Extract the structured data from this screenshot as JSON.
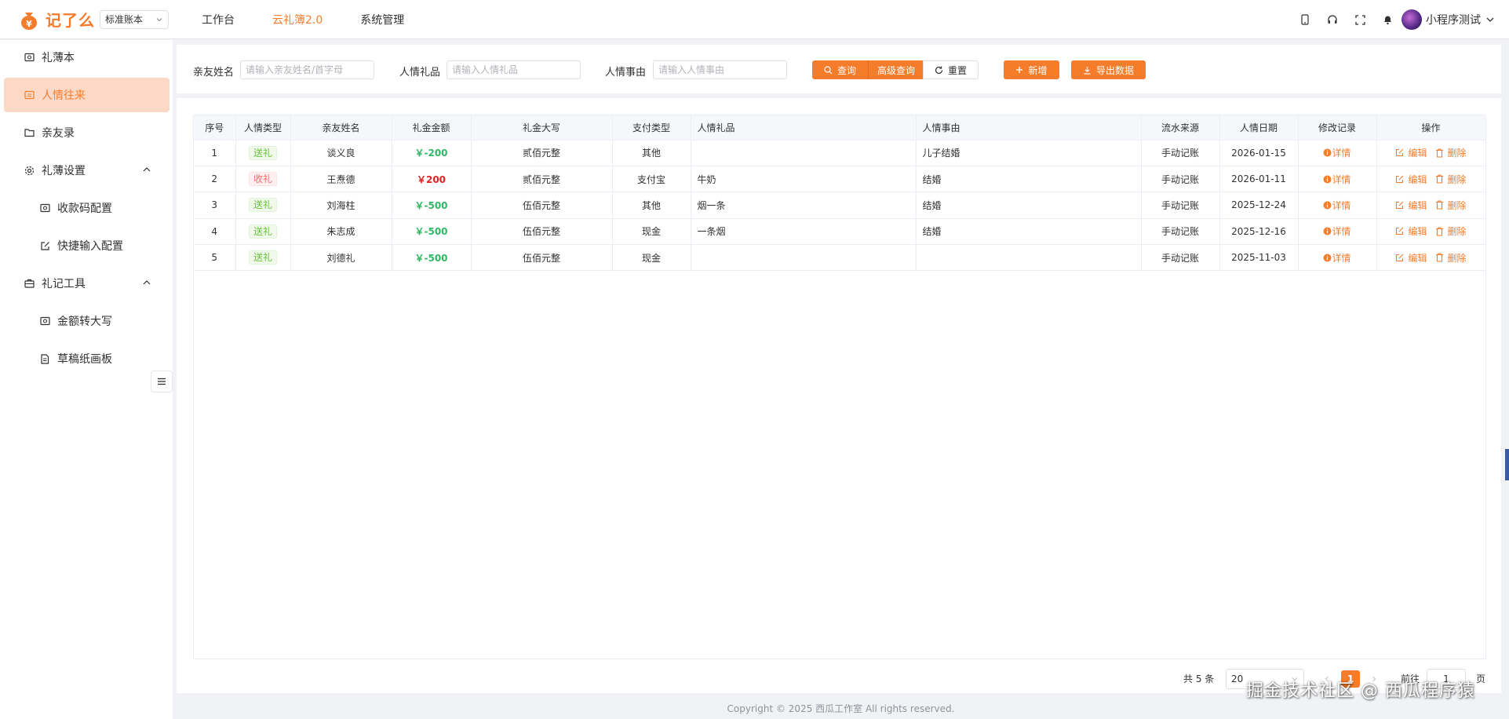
{
  "app": {
    "logo_text": "记了么",
    "book_select": "标准账本",
    "nav": [
      "工作台",
      "云礼簿2.0",
      "系统管理"
    ],
    "user_name": "小程序测试"
  },
  "sidebar": {
    "items": [
      {
        "label": "礼薄本"
      },
      {
        "label": "人情往来"
      },
      {
        "label": "亲友录"
      },
      {
        "label": "礼薄设置"
      },
      {
        "label": "收款码配置"
      },
      {
        "label": "快捷输入配置"
      },
      {
        "label": "礼记工具"
      },
      {
        "label": "金额转大写"
      },
      {
        "label": "草稿纸画板"
      }
    ]
  },
  "search": {
    "name_label": "亲友姓名",
    "name_placeholder": "请输入亲友姓名/首字母",
    "gift_label": "人情礼品",
    "gift_placeholder": "请输入人情礼品",
    "reason_label": "人情事由",
    "reason_placeholder": "请输入人情事由",
    "query": "查询",
    "advanced": "高级查询",
    "reset": "重置",
    "add": "新增",
    "export": "导出数据"
  },
  "table": {
    "headers": [
      "序号",
      "人情类型",
      "亲友姓名",
      "礼金金额",
      "礼金大写",
      "支付类型",
      "人情礼品",
      "人情事由",
      "流水来源",
      "人情日期",
      "修改记录",
      "操作"
    ],
    "rows": [
      {
        "idx": "1",
        "type": "送礼",
        "name": "谈义良",
        "amount": "￥-200",
        "upper": "贰佰元整",
        "pay": "其他",
        "gift": "",
        "reason": "儿子结婚",
        "source": "手动记账",
        "date": "2026-01-15"
      },
      {
        "idx": "2",
        "type": "收礼",
        "name": "王焘德",
        "amount": "￥200",
        "upper": "贰佰元整",
        "pay": "支付宝",
        "gift": "牛奶",
        "reason": "结婚",
        "source": "手动记账",
        "date": "2026-01-11"
      },
      {
        "idx": "3",
        "type": "送礼",
        "name": "刘海柱",
        "amount": "￥-500",
        "upper": "伍佰元整",
        "pay": "其他",
        "gift": "烟一条",
        "reason": "结婚",
        "source": "手动记账",
        "date": "2025-12-24"
      },
      {
        "idx": "4",
        "type": "送礼",
        "name": "朱志成",
        "amount": "￥-500",
        "upper": "伍佰元整",
        "pay": "现金",
        "gift": "一条烟",
        "reason": "结婚",
        "source": "手动记账",
        "date": "2025-12-16"
      },
      {
        "idx": "5",
        "type": "送礼",
        "name": "刘德礼",
        "amount": "￥-500",
        "upper": "伍佰元整",
        "pay": "现金",
        "gift": "",
        "reason": "",
        "source": "手动记账",
        "date": "2025-11-03"
      }
    ],
    "detail": "详情",
    "edit": "编辑",
    "delete": "删除"
  },
  "pagination": {
    "total": "共 5 条",
    "page_size": "20",
    "current": "1",
    "goto": "前往",
    "goto_value": "1",
    "page_unit": "页"
  },
  "footer": "Copyright © 2025 西瓜工作室 All rights reserved.",
  "watermark": "掘金技术社区 @ 西瓜程序猿",
  "colors": {
    "accent": "#f57c2b",
    "send": "#67c23a",
    "receive": "#f56c6c",
    "amount_negative": "#2fb863",
    "amount_positive": "#e02424"
  }
}
